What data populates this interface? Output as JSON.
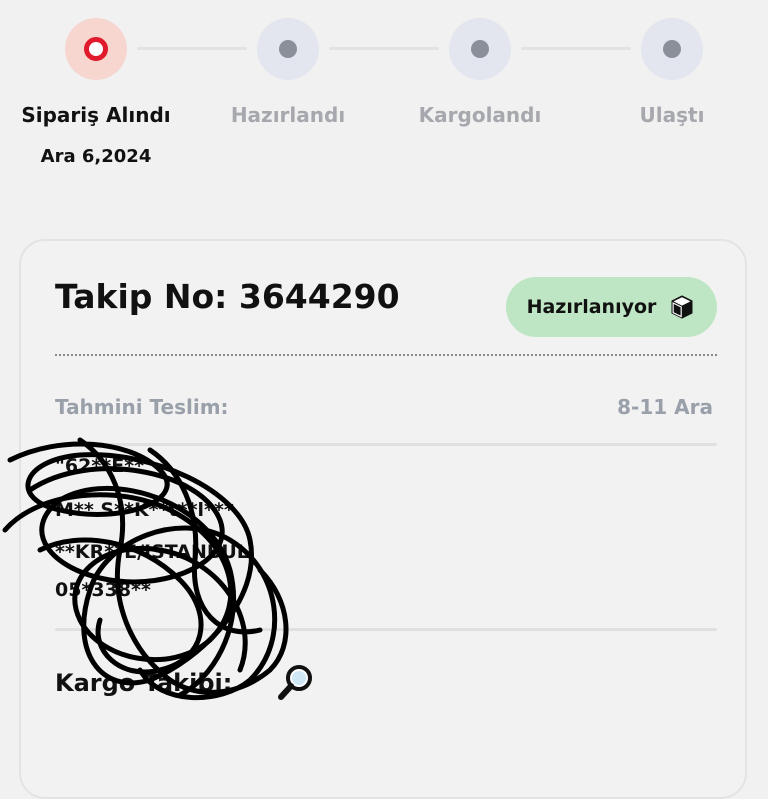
{
  "stepper": {
    "steps": [
      {
        "label": "Sipariş Alındı",
        "date": "Ara 6,2024",
        "active": true
      },
      {
        "label": "Hazırlandı",
        "active": false
      },
      {
        "label": "Kargolandı",
        "active": false
      },
      {
        "label": "Ulaştı",
        "active": false
      }
    ]
  },
  "card": {
    "tracking_title": "Takip No: 3644290",
    "status_badge": {
      "label": "Hazırlanıyor",
      "icon": "package-icon",
      "color": "#bfe6c4"
    },
    "estimated_delivery": {
      "label": "Tahmini Teslim:",
      "value": "8-11 Ara"
    },
    "address": {
      "line1": "\"62**E**",
      "line2": "M** S**K**t**l***",
      "line3": "**KR**E/ISTANBUL",
      "line4": "05*338**"
    },
    "cargo_tracking": {
      "label": "Kargo Takibi:",
      "icon": "magnifier-icon"
    }
  },
  "colors": {
    "accent_red": "#e11a2c",
    "active_circle_bg": "#f6d6cf",
    "inactive_circle_bg": "#e3e6ee",
    "inactive_text": "#a6a8ae",
    "badge_green": "#bfe6c4"
  }
}
